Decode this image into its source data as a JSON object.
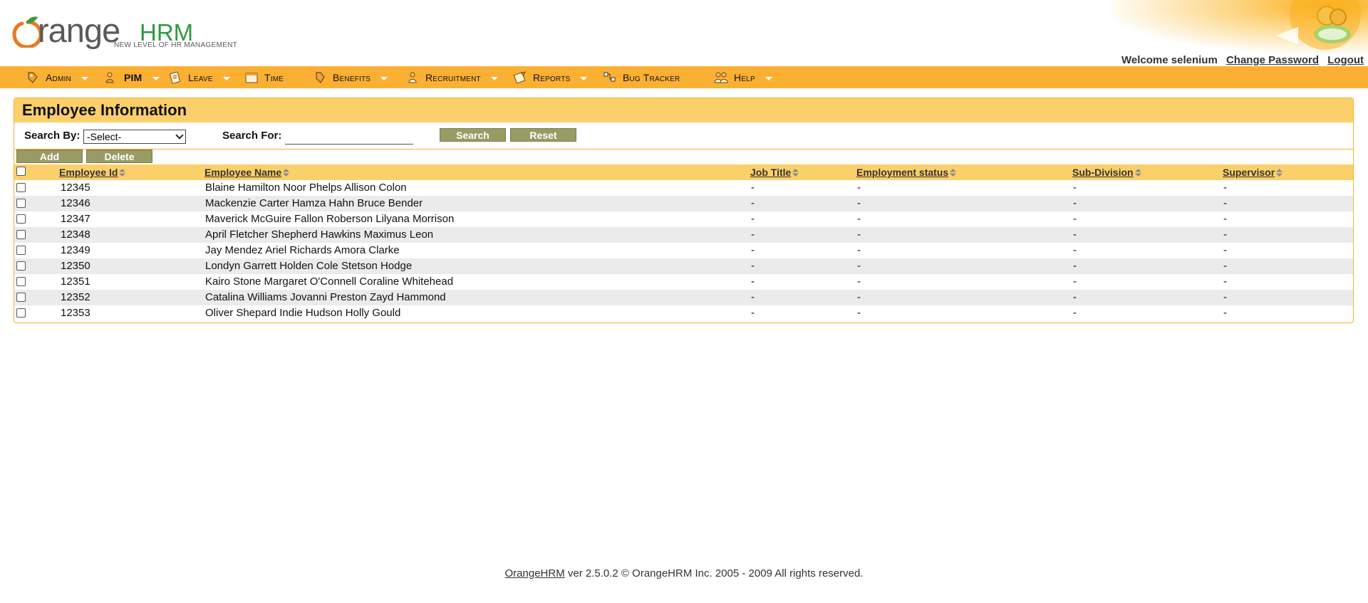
{
  "brand": {
    "logo_word": "range",
    "logo_hrm": "HRM",
    "tagline": "NEW LEVEL OF HR MANAGEMENT"
  },
  "user_links": {
    "welcome": "Welcome selenium",
    "change_password": "Change Password",
    "logout": "Logout"
  },
  "menu": [
    {
      "label": "Admin",
      "icon": "admin-icon",
      "has_dropdown": true
    },
    {
      "label": "PIM",
      "icon": "pim-icon",
      "has_dropdown": true,
      "active": true
    },
    {
      "label": "Leave",
      "icon": "leave-icon",
      "has_dropdown": true
    },
    {
      "label": "Time",
      "icon": "time-icon",
      "has_dropdown": false
    },
    {
      "label": "Benefits",
      "icon": "benefits-icon",
      "has_dropdown": true
    },
    {
      "label": "Recruitment",
      "icon": "recruitment-icon",
      "has_dropdown": true
    },
    {
      "label": "Reports",
      "icon": "reports-icon",
      "has_dropdown": true
    },
    {
      "label": "Bug Tracker",
      "icon": "bug-tracker-icon",
      "has_dropdown": false
    },
    {
      "label": "Help",
      "icon": "help-icon",
      "has_dropdown": true
    }
  ],
  "panel": {
    "title": "Employee Information",
    "search_by_label": "Search By:",
    "search_by_value": "-Select-",
    "search_for_label": "Search For:",
    "search_for_value": "",
    "search_button": "Search",
    "reset_button": "Reset",
    "add_button": "Add",
    "delete_button": "Delete"
  },
  "table": {
    "columns": [
      "Employee Id",
      "Employee Name",
      "Job Title",
      "Employment status",
      "Sub-Division",
      "Supervisor"
    ],
    "rows": [
      {
        "id": "12345",
        "name": "Blaine Hamilton Noor Phelps Allison Colon",
        "job_title": "-",
        "status": "-",
        "sub_division": "-",
        "supervisor": "-"
      },
      {
        "id": "12346",
        "name": "Mackenzie Carter Hamza Hahn Bruce Bender",
        "job_title": "-",
        "status": "-",
        "sub_division": "-",
        "supervisor": "-"
      },
      {
        "id": "12347",
        "name": "Maverick McGuire Fallon Roberson Lilyana Morrison",
        "job_title": "-",
        "status": "-",
        "sub_division": "-",
        "supervisor": "-"
      },
      {
        "id": "12348",
        "name": "April Fletcher Shepherd Hawkins Maximus Leon",
        "job_title": "-",
        "status": "-",
        "sub_division": "-",
        "supervisor": "-"
      },
      {
        "id": "12349",
        "name": "Jay Mendez Ariel Richards Amora Clarke",
        "job_title": "-",
        "status": "-",
        "sub_division": "-",
        "supervisor": "-"
      },
      {
        "id": "12350",
        "name": "Londyn Garrett Holden Cole Stetson Hodge",
        "job_title": "-",
        "status": "-",
        "sub_division": "-",
        "supervisor": "-"
      },
      {
        "id": "12351",
        "name": "Kairo Stone Margaret O'Connell Coraline Whitehead",
        "job_title": "-",
        "status": "-",
        "sub_division": "-",
        "supervisor": "-"
      },
      {
        "id": "12352",
        "name": "Catalina Williams Jovanni Preston Zayd Hammond",
        "job_title": "-",
        "status": "-",
        "sub_division": "-",
        "supervisor": "-"
      },
      {
        "id": "12353",
        "name": "Oliver Shepard Indie Hudson Holly Gould",
        "job_title": "-",
        "status": "-",
        "sub_division": "-",
        "supervisor": "-"
      }
    ]
  },
  "footer": {
    "link": "OrangeHRM",
    "text": " ver 2.5.0.2 © OrangeHRM Inc. 2005 - 2009 All rights reserved."
  },
  "colors": {
    "menu_bar": "#fbb034",
    "panel_header": "#fbd06b",
    "button": "#9a9a64",
    "row_alt": "#ebebeb"
  }
}
